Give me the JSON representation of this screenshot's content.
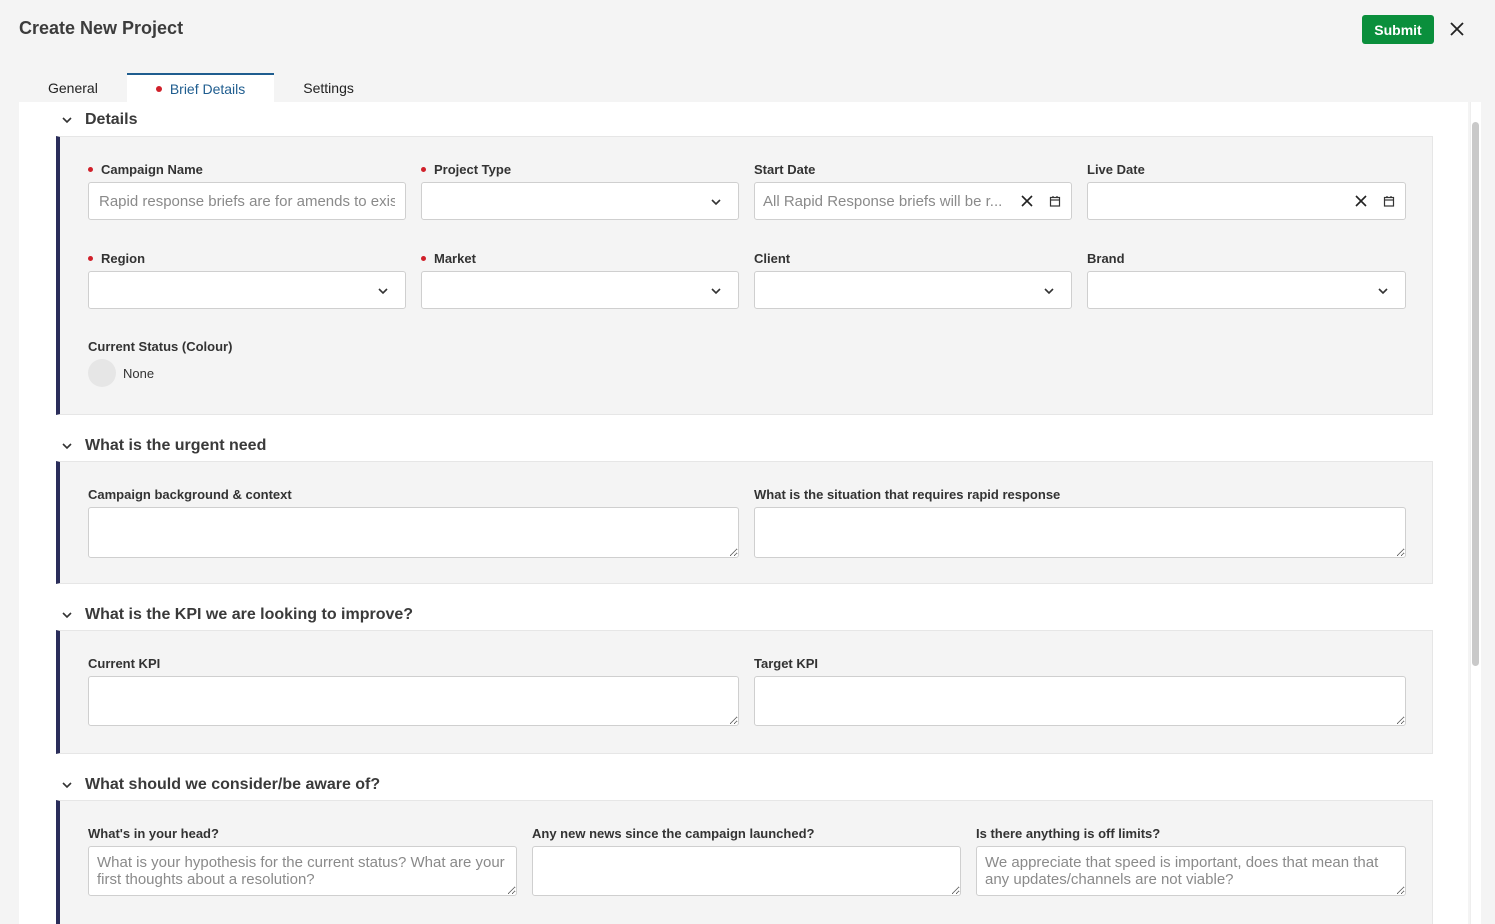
{
  "header": {
    "title": "Create New Project",
    "submit_label": "Submit"
  },
  "tabs": [
    {
      "label": "General"
    },
    {
      "label": "Brief Details"
    },
    {
      "label": "Settings"
    }
  ],
  "sections": {
    "details": {
      "title": "Details",
      "campaign_name": {
        "label": "Campaign Name",
        "placeholder": "Rapid response briefs are for amends to existing campaigns",
        "value": ""
      },
      "project_type": {
        "label": "Project Type",
        "value": ""
      },
      "start_date": {
        "label": "Start Date",
        "placeholder": "All Rapid Response briefs will be r..."
      },
      "live_date": {
        "label": "Live Date",
        "placeholder": ""
      },
      "region": {
        "label": "Region",
        "value": ""
      },
      "market": {
        "label": "Market",
        "value": ""
      },
      "client": {
        "label": "Client",
        "value": ""
      },
      "brand": {
        "label": "Brand",
        "value": ""
      },
      "current_status": {
        "label": "Current Status (Colour)",
        "value": "None"
      }
    },
    "urgent_need": {
      "title": "What is the urgent need",
      "background": {
        "label": "Campaign background & context",
        "placeholder": ""
      },
      "situation": {
        "label": "What is the situation that requires rapid response",
        "placeholder": ""
      }
    },
    "kpi": {
      "title": "What is the KPI we are looking to improve?",
      "current": {
        "label": "Current KPI",
        "placeholder": ""
      },
      "target": {
        "label": "Target KPI",
        "placeholder": ""
      }
    },
    "consider": {
      "title": "What should we consider/be aware of?",
      "head": {
        "label": "What's in your head?",
        "placeholder": "What is your hypothesis for the current status? What are your first thoughts about a resolution?"
      },
      "news": {
        "label": "Any new news since the campaign launched?",
        "placeholder": ""
      },
      "limits": {
        "label": "Is there anything is off limits?",
        "placeholder": "We appreciate that speed is important, does that mean that any updates/channels are not viable?"
      }
    }
  },
  "colors": {
    "accent": "#1f5d8f",
    "submit": "#0a8f3c",
    "required": "#d0202a",
    "panel_bar": "#2a2d5a"
  },
  "icons": {
    "close": "close-icon",
    "chevron": "chevron-down-icon",
    "calendar": "calendar-icon",
    "clear": "clear-icon"
  }
}
